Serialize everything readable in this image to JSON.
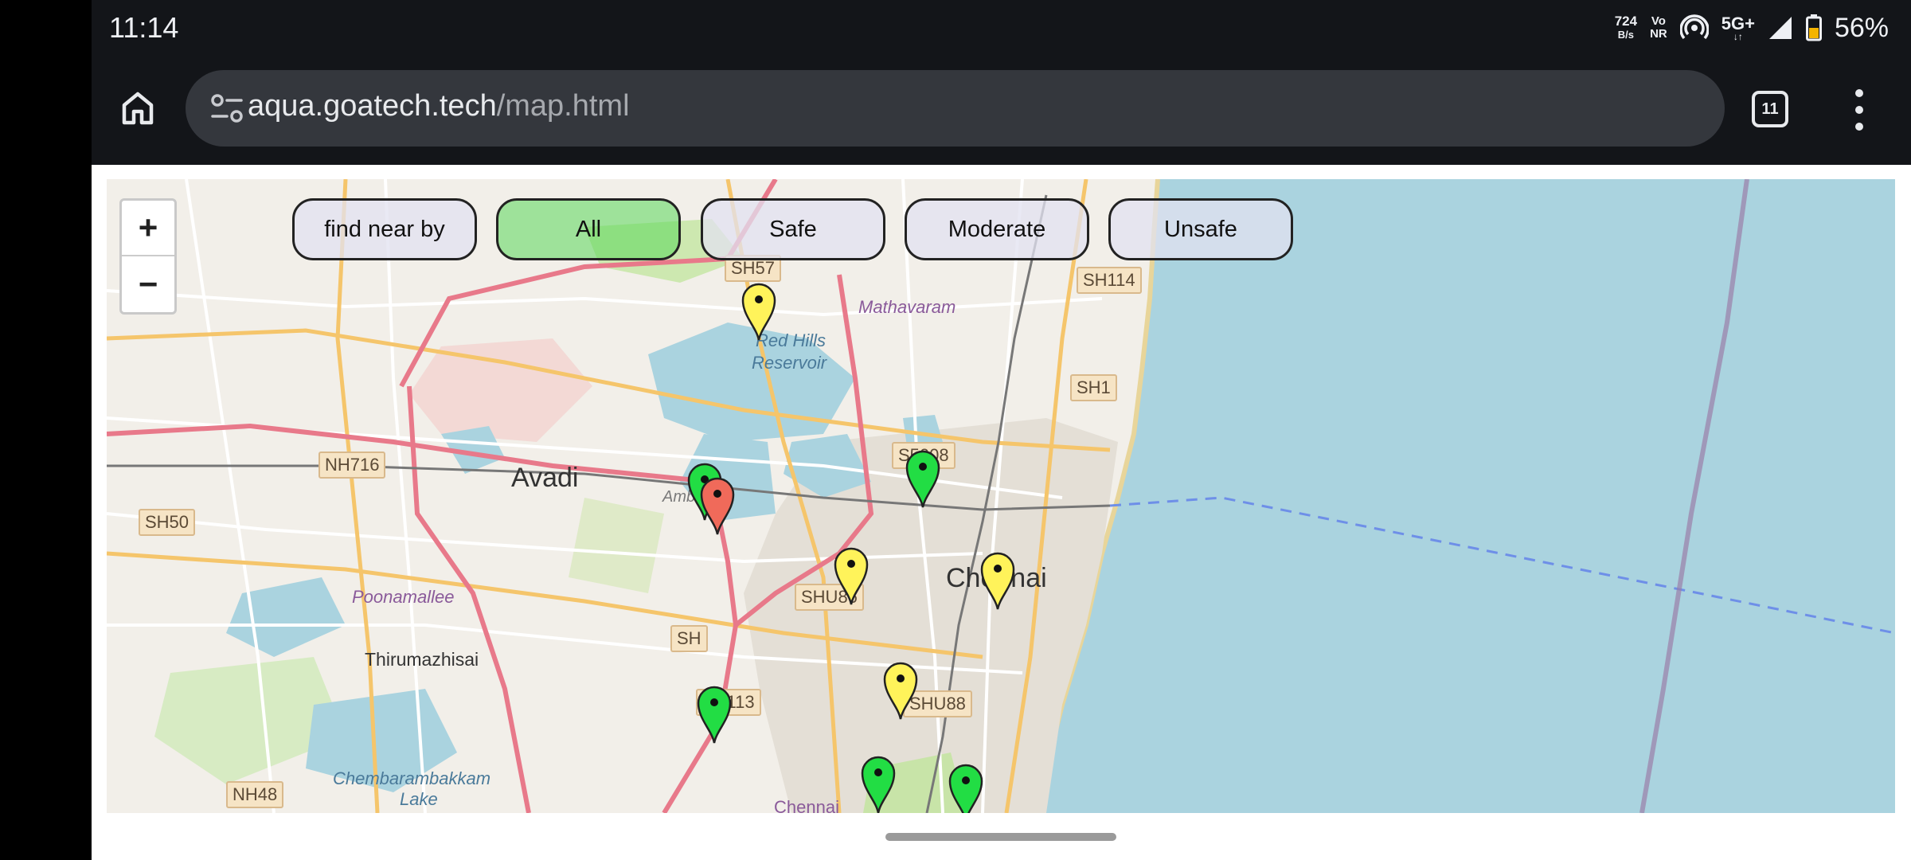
{
  "status_bar": {
    "time": "11:14",
    "net_speed": "724",
    "net_speed_unit": "B/s",
    "volte_top": "Vo",
    "volte_bottom": "NR",
    "network": "5G+",
    "network_arrows": "↓↑",
    "battery": "56%"
  },
  "browser": {
    "url_domain": "aqua.goatech.tech",
    "url_path": "/map.html",
    "tab_count": "11"
  },
  "map": {
    "zoom_in": "+",
    "zoom_out": "−",
    "filters": {
      "find_nearby": "find near by",
      "all": "All",
      "safe": "Safe",
      "moderate": "Moderate",
      "unsafe": "Unsafe"
    },
    "labels": {
      "avadi": "Avadi",
      "chennai": "Chennai",
      "mathavaram": "Mathavaram",
      "red_hills": "Red Hills",
      "reservoir": "Reservoir",
      "poonamallee": "Poonamallee",
      "thirumazhisai": "Thirumazhisai",
      "chembarambakkam": "Chembarambakkam",
      "lake": "Lake",
      "ambattur": "Ambattur",
      "chennai_bottom": "Chennai"
    },
    "shields": {
      "sh57": "SH57",
      "sh114": "SH114",
      "sh1": "SH1",
      "nh716": "NH716",
      "sh50": "SH50",
      "s5008": "S5008",
      "shu86": "SHU86",
      "sh_partial": "SH",
      "sh113": "SH113",
      "shu88": "SHU88",
      "nh48": "NH48"
    },
    "marker_colors": {
      "safe": "#22dd44",
      "moderate": "#fff35a",
      "unsafe": "#f06a5a"
    },
    "markers": [
      {
        "status": "moderate"
      },
      {
        "status": "safe"
      },
      {
        "status": "unsafe"
      },
      {
        "status": "safe"
      },
      {
        "status": "moderate"
      },
      {
        "status": "moderate"
      },
      {
        "status": "moderate"
      },
      {
        "status": "safe"
      },
      {
        "status": "safe"
      },
      {
        "status": "safe"
      }
    ]
  }
}
